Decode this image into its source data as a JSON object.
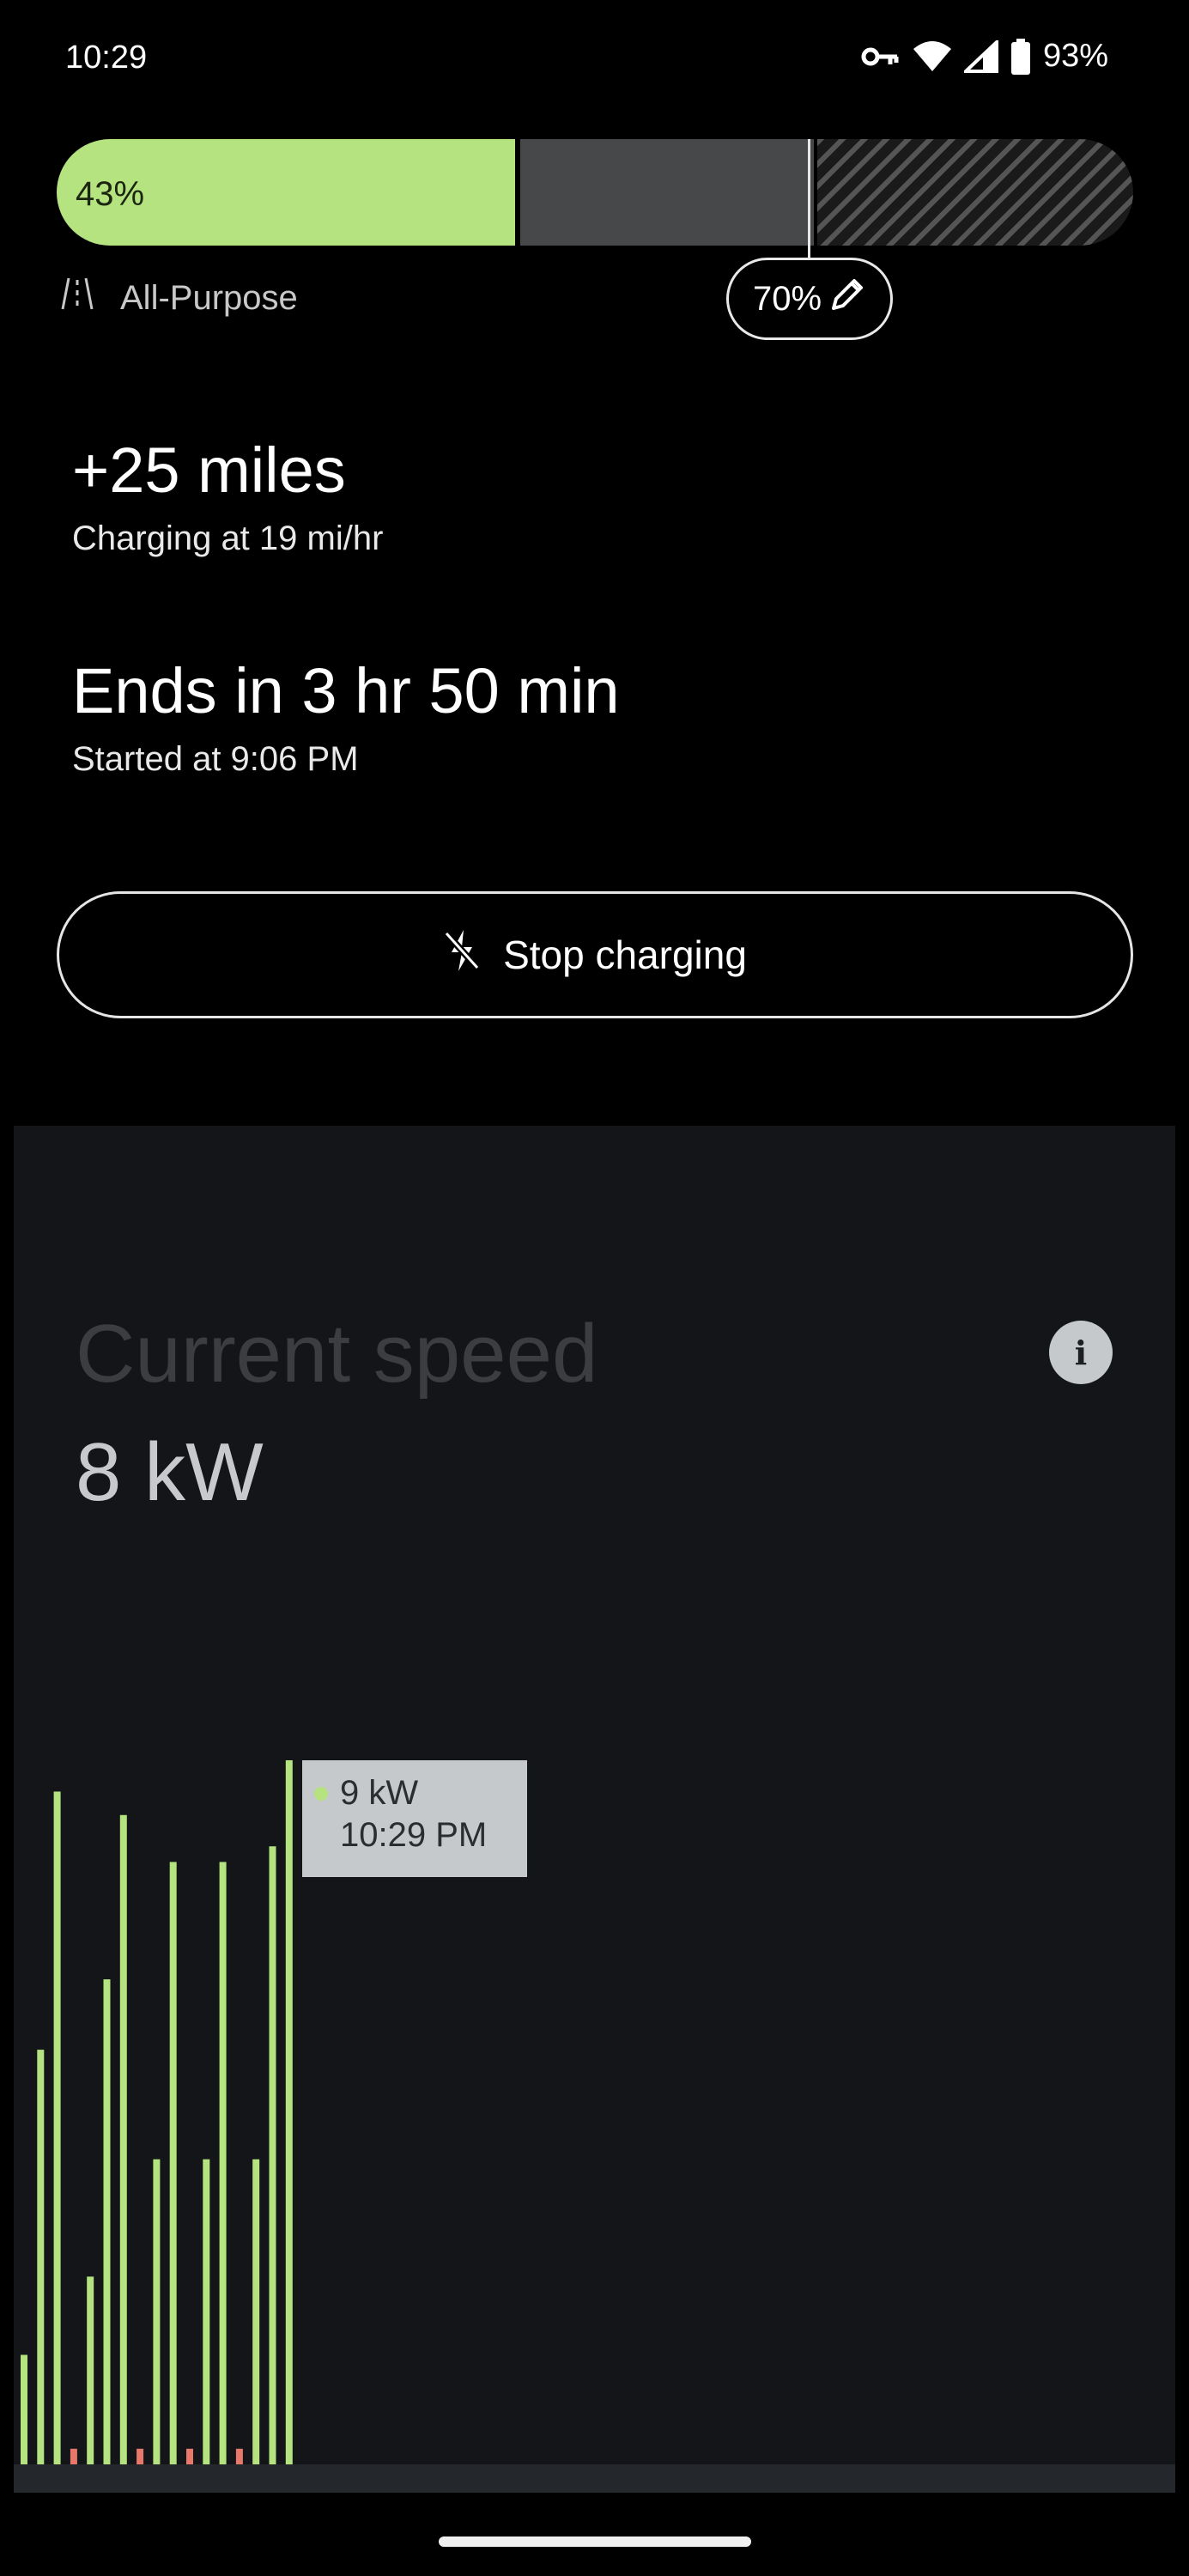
{
  "status_bar": {
    "time": "10:29",
    "battery_text": "93%",
    "icons": [
      "vpn-key-icon",
      "wifi-icon",
      "cell-signal-icon",
      "battery-icon"
    ]
  },
  "battery": {
    "charge_label": "43%",
    "charge_level": 0.43,
    "limit_label": "70%",
    "limit_level": 0.7,
    "mode_label": "All-Purpose",
    "colors": {
      "charged": "#b5e37f",
      "target": "#474849"
    }
  },
  "stats": {
    "miles_added": "+25 miles",
    "charging_rate": "Charging at 19 mi/hr",
    "ends_in": "Ends in 3 hr 50 min",
    "started_at": "Started at 9:06 PM"
  },
  "actions": {
    "stop_label": "Stop charging"
  },
  "speed": {
    "title": "Current speed",
    "value": "8 kW",
    "tooltip_value": "9 kW",
    "tooltip_time": "10:29 PM"
  },
  "chart_data": {
    "type": "bar",
    "ylim": [
      0,
      9
    ],
    "values": [
      1.4,
      5.3,
      8.6,
      0.2,
      2.4,
      6.2,
      8.3,
      0.2,
      3.9,
      7.7,
      0.2,
      3.9,
      7.7,
      0.2,
      3.9,
      7.9,
      9.0
    ],
    "bar_colors": [
      "green",
      "green",
      "green",
      "red",
      "green",
      "green",
      "green",
      "red",
      "green",
      "green",
      "red",
      "green",
      "green",
      "red",
      "green",
      "green",
      "green"
    ],
    "colors": {
      "green": "#b5e37f",
      "red": "#e8786a"
    }
  }
}
